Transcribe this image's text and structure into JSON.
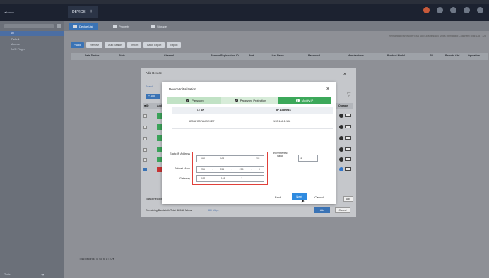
{
  "topbar": {
    "home_label": "◂ Home",
    "tabs": [
      {
        "label": "DEVICE"
      }
    ],
    "add_tab": "+"
  },
  "sidebar": {
    "search_placeholder": "Search",
    "items": [
      {
        "label": "All"
      },
      {
        "label": "Default"
      },
      {
        "label": "Access"
      },
      {
        "label": "NVR Plugin"
      }
    ],
    "footer_label": "Tools",
    "footer_icon": "arrow"
  },
  "main": {
    "subtabs": [
      {
        "label": "Device List"
      },
      {
        "label": "Property"
      },
      {
        "label": "Storage"
      }
    ],
    "status_line": "Remaining Bandwidth/Total 480/18 Mbps/480 Mbps   Remaining Channels/Total   128 / 128",
    "toolbar": [
      "+ Add",
      "Remove",
      "Auto Search",
      "Import",
      "Batch Export",
      "Export"
    ],
    "columns": [
      "Date Device",
      "State",
      "Channel",
      "Remote Registration ID",
      "Port",
      "User Name",
      "Password",
      "Manufacturer",
      "Product Model",
      "SN",
      "Remote Ctrl",
      "Operation"
    ],
    "pager": "Total Records: 78 Go to 1 | 10 ▾"
  },
  "add_device": {
    "title": "Add Device",
    "close": "×",
    "search_link": "Search",
    "add_button": "+ Add",
    "col_check": "■ ID",
    "col_name": "Add",
    "col_operate": "Operate",
    "total": "Total 8 Records",
    "add_label": "Add",
    "remaining_label": "Remaining Bandwidth/Total: 480/18 Mbps/",
    "remaining_value": "480 Mbps",
    "add_btn2": "Add",
    "cancel_btn2": "Cancel"
  },
  "init_modal": {
    "title": "Device Initialization",
    "close": "×",
    "steps": [
      {
        "label": "Password",
        "state": "done"
      },
      {
        "label": "Password Protection",
        "state": "done"
      },
      {
        "label": "Modify IP",
        "state": "active"
      }
    ],
    "table": {
      "col_sn": "SN",
      "col_ip": "IP Address",
      "rows": [
        {
          "sn": "6B0AFC0PAMDE4E7",
          "ip": "192.168.1.108"
        }
      ]
    },
    "fields": {
      "static_ip_label": "Static IP Address",
      "static_ip": [
        "192",
        "168",
        "1",
        "101"
      ],
      "subnet_label": "Subnet Mask",
      "subnet": [
        "255",
        "255",
        "255",
        "0"
      ],
      "gateway_label": "Gateway",
      "gateway": [
        "192",
        "168",
        "1",
        "1"
      ],
      "incremental_label": "Incremental Value",
      "incremental_value": "1"
    },
    "buttons": {
      "back": "Back",
      "next": "Next",
      "cancel": "Cancel"
    }
  }
}
